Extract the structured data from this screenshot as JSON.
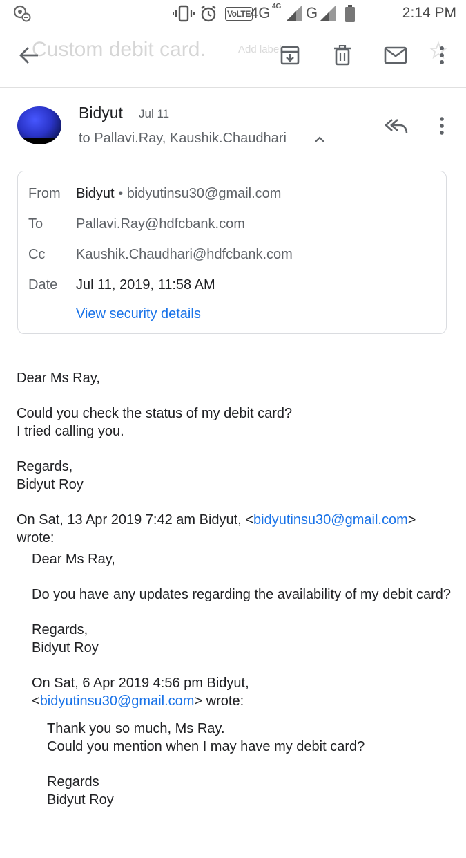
{
  "status_bar": {
    "time": "2:14 PM",
    "volte": "VoLTE",
    "network_4g": "4G",
    "network_4g_sup": "4G",
    "network_g": "G"
  },
  "toolbar": {
    "subject": "Custom debit card.",
    "label_hint": "Add label",
    "icons": [
      "back-arrow-icon",
      "archive-icon",
      "delete-icon",
      "mark-unread-icon",
      "star-icon",
      "more-vert-icon"
    ]
  },
  "message": {
    "sender_name": "Bidyut",
    "date_short": "Jul 11",
    "recipients_line": "to Pallavi.Ray, Kaushik.Chaudhari"
  },
  "details": {
    "from_label": "From",
    "from_name": "Bidyut",
    "from_email": "bidyutinsu30@gmail.com",
    "to_label": "To",
    "to_value": "Pallavi.Ray@hdfcbank.com",
    "cc_label": "Cc",
    "cc_value": "Kaushik.Chaudhari@hdfcbank.com",
    "date_label": "Date",
    "date_value": "Jul 11, 2019, 11:58 AM",
    "security_link": "View security details"
  },
  "body": {
    "greeting": "Dear Ms Ray,",
    "line1": "Could you check the status of my debit card?",
    "line2": "I tried calling you.",
    "regards": "Regards,",
    "signature": "Bidyut Roy",
    "quote_header_prefix": "On Sat, 13 Apr 2019 7:42 am Bidyut, <",
    "quote_header_email": "bidyutinsu30@gmail.com",
    "quote_header_suffix": ">",
    "quote_header_wrote": "wrote:"
  },
  "quote1": {
    "greeting": "Dear Ms Ray,",
    "line1": "Do you have any updates regarding the availability of my debit card?",
    "regards": "Regards,",
    "signature": "Bidyut Roy",
    "header_line1": "On Sat, 6 Apr 2019 4:56 pm Bidyut,",
    "header_prefix": "<",
    "header_email": "bidyutinsu30@gmail.com",
    "header_suffix": "> wrote:"
  },
  "quote2": {
    "line1": "Thank you so much, Ms Ray.",
    "line2": "Could you mention when I may have my debit card?",
    "regards": "Regards",
    "signature": "Bidyut Roy"
  }
}
